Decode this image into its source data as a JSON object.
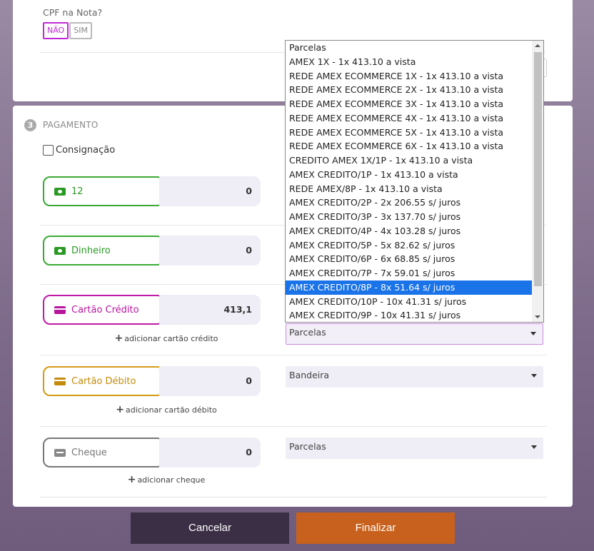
{
  "cpf": {
    "label": "CPF na Nota?",
    "no": "NÃO",
    "yes": "SIM",
    "selected": "NÃO"
  },
  "payment": {
    "step_number": "3",
    "title": "PAGAMENTO",
    "consignment_label": "Consignação",
    "methods": [
      {
        "label": "12",
        "amount": "0",
        "color": "#3aaa35"
      },
      {
        "label": "Dinheiro",
        "amount": "0",
        "color": "#3aaa35"
      },
      {
        "label": "Cartão Crédito",
        "amount": "413,1",
        "color": "#c01aa6",
        "add_label": "adicionar cartão crédito",
        "select_value": "Parcelas"
      },
      {
        "label": "Cartão Débito",
        "amount": "0",
        "color": "#d39a15",
        "add_label": "adicionar cartão débito",
        "select_value": "Bandeira"
      },
      {
        "label": "Cheque",
        "amount": "0",
        "color": "#777777",
        "add_label": "adicionar cheque",
        "select_value": "Parcelas"
      }
    ]
  },
  "dropdown": {
    "selected_index": 17,
    "options": [
      "Parcelas",
      "AMEX 1X - 1x 413.10 a vista",
      "REDE AMEX ECOMMERCE 1X - 1x 413.10 a vista",
      "REDE AMEX ECOMMERCE 2X - 1x 413.10 a vista",
      "REDE AMEX ECOMMERCE 3X - 1x 413.10 a vista",
      "REDE AMEX ECOMMERCE 4X - 1x 413.10 a vista",
      "REDE AMEX ECOMMERCE 5X - 1x 413.10 a vista",
      "REDE AMEX ECOMMERCE 6X - 1x 413.10 a vista",
      "CREDITO AMEX 1X/1P - 1x 413.10 a vista",
      "AMEX CREDITO/1P - 1x 413.10 a vista",
      "REDE AMEX/8P - 1x 413.10 a vista",
      "AMEX CREDITO/2P - 2x 206.55 s/ juros",
      "AMEX CREDITO/3P - 3x 137.70 s/ juros",
      "AMEX CREDITO/4P - 4x 103.28 s/ juros",
      "AMEX CREDITO/5P - 5x 82.62 s/ juros",
      "AMEX CREDITO/6P - 6x 68.85 s/ juros",
      "AMEX CREDITO/7P - 7x 59.01 s/ juros",
      "AMEX CREDITO/8P - 8x 51.64 s/ juros",
      "AMEX CREDITO/10P - 10x 41.31 s/ juros",
      "AMEX CREDITO/9P - 10x 41.31 s/ juros"
    ]
  },
  "actions": {
    "cancel": "Cancelar",
    "finish": "Finalizar"
  },
  "colors": {
    "accent": "#c02ad6",
    "finish": "#c8611d",
    "cancel": "#3b2f45",
    "highlight": "#1a73e8"
  }
}
